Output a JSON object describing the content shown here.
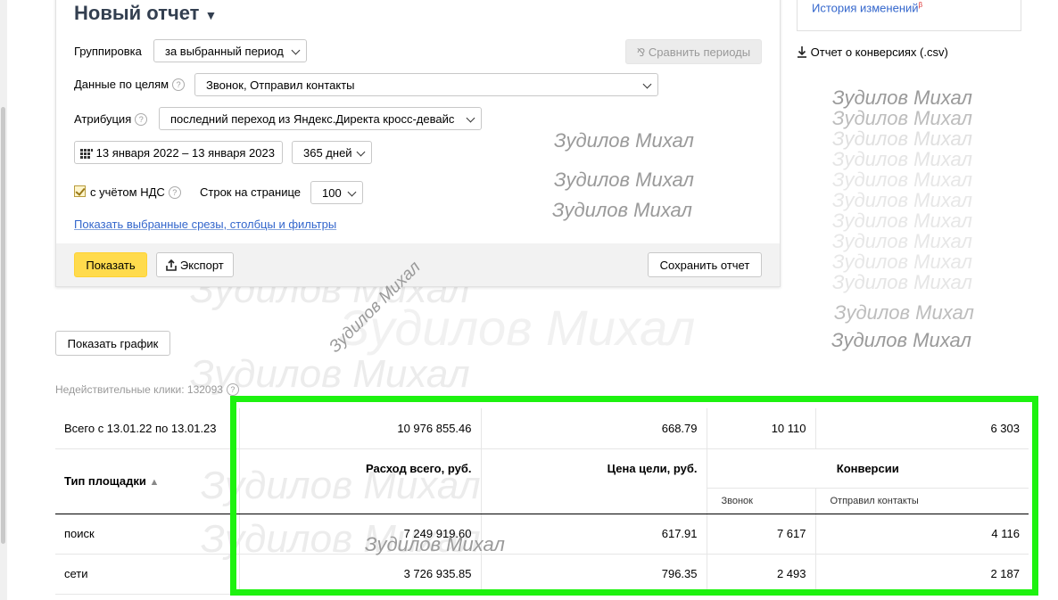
{
  "report": {
    "title": "Новый отчет",
    "title_caret": "▼",
    "grouping_label": "Группировка",
    "grouping_value": "за выбранный период",
    "compare_button": "Сравнить периоды",
    "goals_label": "Данные по целям",
    "goals_value": "Звонок, Отправил контакты",
    "attribution_label": "Атрибуция",
    "attribution_value": "последний переход из Яндекс.Директа кросс-девайс",
    "date_range": "13 января 2022 – 13 января 2023",
    "days_value": "365 дней",
    "vat_label": "с учётом НДС",
    "rows_label": "Строк на странице",
    "rows_value": "100",
    "show_slices_link": "Показать выбранные срезы, столбцы и фильтры",
    "show_button": "Показать",
    "export_button": "Экспорт",
    "save_button": "Сохранить отчет"
  },
  "sidebar": {
    "history_link": "История изменений",
    "history_badge": "β",
    "conversions_link": "Отчет о конверсиях (.csv)"
  },
  "show_chart_button": "Показать график",
  "invalid_clicks": "Недействительные клики: 132093",
  "watermark_text": "Зудилов Михал",
  "table": {
    "total_label": "Всего с 13.01.22 по 13.01.23",
    "total_cost": "10 976 855.46",
    "total_goal_price": "668.79",
    "total_calls": "10 110",
    "total_contacts": "6 303",
    "col_type": "Тип площадки",
    "col_type_sort": "▲",
    "col_cost": "Расход всего, руб.",
    "col_goal_price": "Цена цели, руб.",
    "col_conversions": "Конверсии",
    "sub_calls": "Звонок",
    "sub_contacts": "Отправил контакты",
    "rows": [
      {
        "type": "поиск",
        "cost": "7 249 919.60",
        "goal_price": "617.91",
        "calls": "7 617",
        "contacts": "4 116"
      },
      {
        "type": "сети",
        "cost": "3 726 935.85",
        "goal_price": "796.35",
        "calls": "2 493",
        "contacts": "2 187"
      }
    ]
  },
  "colors": {
    "highlight": "#1df20f",
    "show_button": "#ffdb4d",
    "link": "#3366cc"
  }
}
